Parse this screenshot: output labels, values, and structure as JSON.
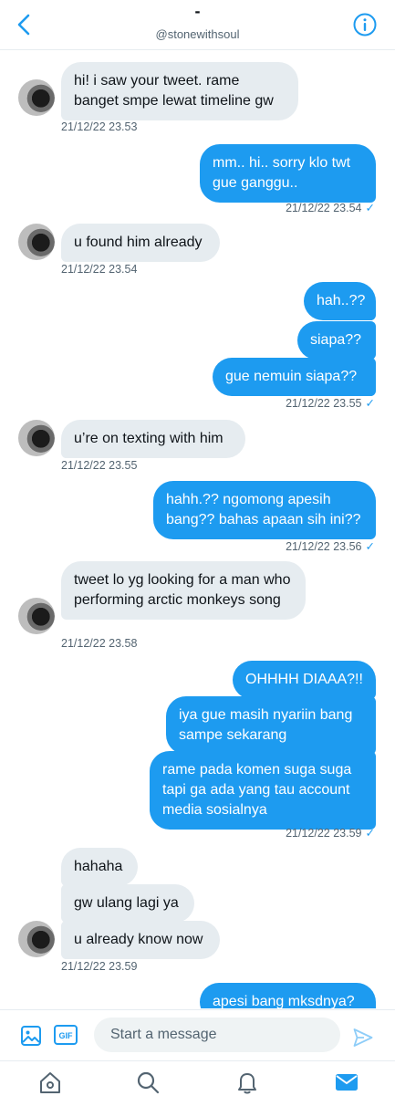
{
  "header": {
    "title": "-",
    "handle": "@stonewithsoul"
  },
  "messages": [
    {
      "dir": "in",
      "text": "hi! i saw your tweet. rame banget smpe lewat timeline gw"
    },
    {
      "dir": "in",
      "time": "21/12/22 23.53"
    },
    {
      "dir": "out",
      "text": "mm.. hi.. sorry klo twt gue ganggu.."
    },
    {
      "dir": "out",
      "time": "21/12/22 23.54"
    },
    {
      "dir": "in",
      "text": "u found him already"
    },
    {
      "dir": "in",
      "time": "21/12/22 23.54"
    },
    {
      "dir": "out",
      "text": "hah..??"
    },
    {
      "dir": "out",
      "text": "siapa??"
    },
    {
      "dir": "out",
      "text": "gue nemuin siapa??"
    },
    {
      "dir": "out",
      "time": "21/12/22 23.55"
    },
    {
      "dir": "in",
      "text": "u’re on texting with him"
    },
    {
      "dir": "in",
      "time": "21/12/22 23.55"
    },
    {
      "dir": "out",
      "text": "hahh.?? ngomong apesih bang?? bahas apaan sih ini??"
    },
    {
      "dir": "out",
      "time": "21/12/22 23.56"
    },
    {
      "dir": "in",
      "text": "tweet lo yg looking for a man who performing arctic monkeys song"
    },
    {
      "dir": "in",
      "time": "21/12/22 23.58"
    },
    {
      "dir": "out",
      "text": "OHHHH DIAAA?!!"
    },
    {
      "dir": "out",
      "text": "iya gue masih nyariin bang sampe sekarang"
    },
    {
      "dir": "out",
      "text": "rame pada komen suga suga tapi ga ada yang tau account media sosialnya"
    },
    {
      "dir": "out",
      "time": "21/12/22 23.59"
    },
    {
      "dir": "in",
      "text": "hahaha"
    },
    {
      "dir": "in",
      "text": "gw ulang lagi ya"
    },
    {
      "dir": "in",
      "text": "u already know now"
    },
    {
      "dir": "in",
      "time": "21/12/22 23.59"
    },
    {
      "dir": "out",
      "text": "apesi bang mksdnya?"
    }
  ],
  "read_tick": "✓",
  "composer": {
    "placeholder": "Start a message",
    "gif_label": "GIF"
  },
  "icons": {
    "back": "chevron-left-icon",
    "info": "info-icon",
    "image": "image-icon",
    "gif": "gif-icon",
    "send": "send-icon",
    "home": "home-icon",
    "search": "search-icon",
    "notifications": "bell-icon",
    "messages": "mail-icon"
  },
  "colors": {
    "accent": "#1d9bf0",
    "incoming_bubble": "#e6ecf0",
    "secondary_text": "#536471"
  }
}
